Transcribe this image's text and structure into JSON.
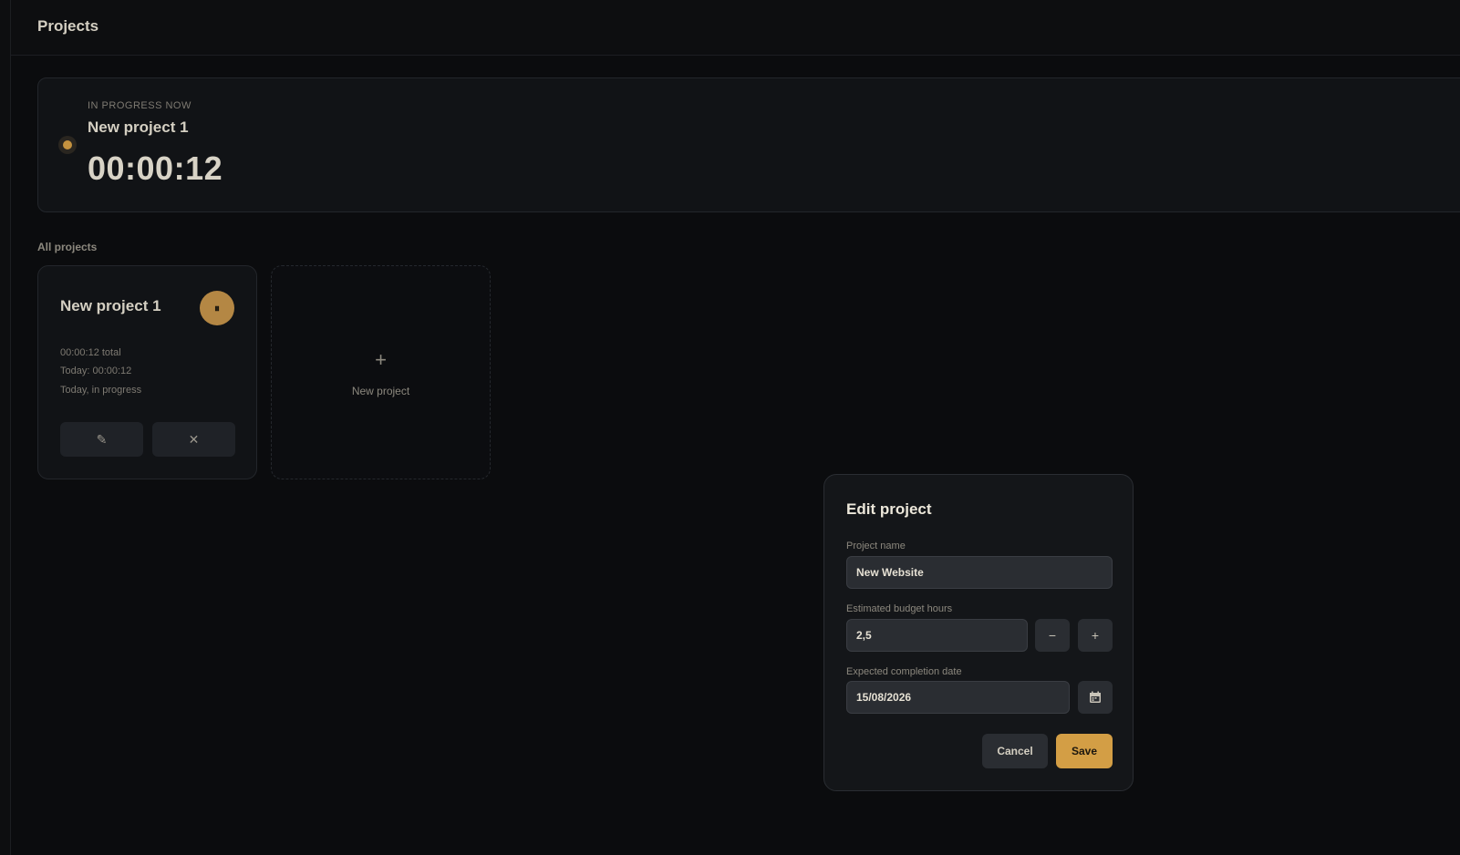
{
  "header": {
    "title": "Projects"
  },
  "active": {
    "label": "IN PROGRESS NOW",
    "project_name": "New project 1",
    "timer": "00:00:12"
  },
  "projects_section": {
    "label": "All projects"
  },
  "project_card": {
    "title": "New project 1",
    "pause_glyph": "⏸",
    "total": "00:00:12 total",
    "today": "Today: 00:00:12",
    "status": "Today, in progress",
    "edit_glyph": "✎",
    "delete_glyph": "✕"
  },
  "new_card": {
    "plus": "+",
    "label": "New project"
  },
  "modal": {
    "title": "Edit project",
    "name_label": "Project name",
    "name_value": "New Website",
    "budget_label": "Estimated budget hours",
    "budget_value": "2,5",
    "minus": "−",
    "plus": "+",
    "date_label": "Expected completion date",
    "date_value": "15/08/2026",
    "cancel": "Cancel",
    "save": "Save"
  },
  "colors": {
    "accent": "#d39e45",
    "background": "#0b0c0e",
    "panel": "#111316"
  },
  "icons": [
    "pause-icon",
    "pencil-icon",
    "close-icon",
    "plus-icon",
    "minus-icon",
    "calendar-icon"
  ]
}
